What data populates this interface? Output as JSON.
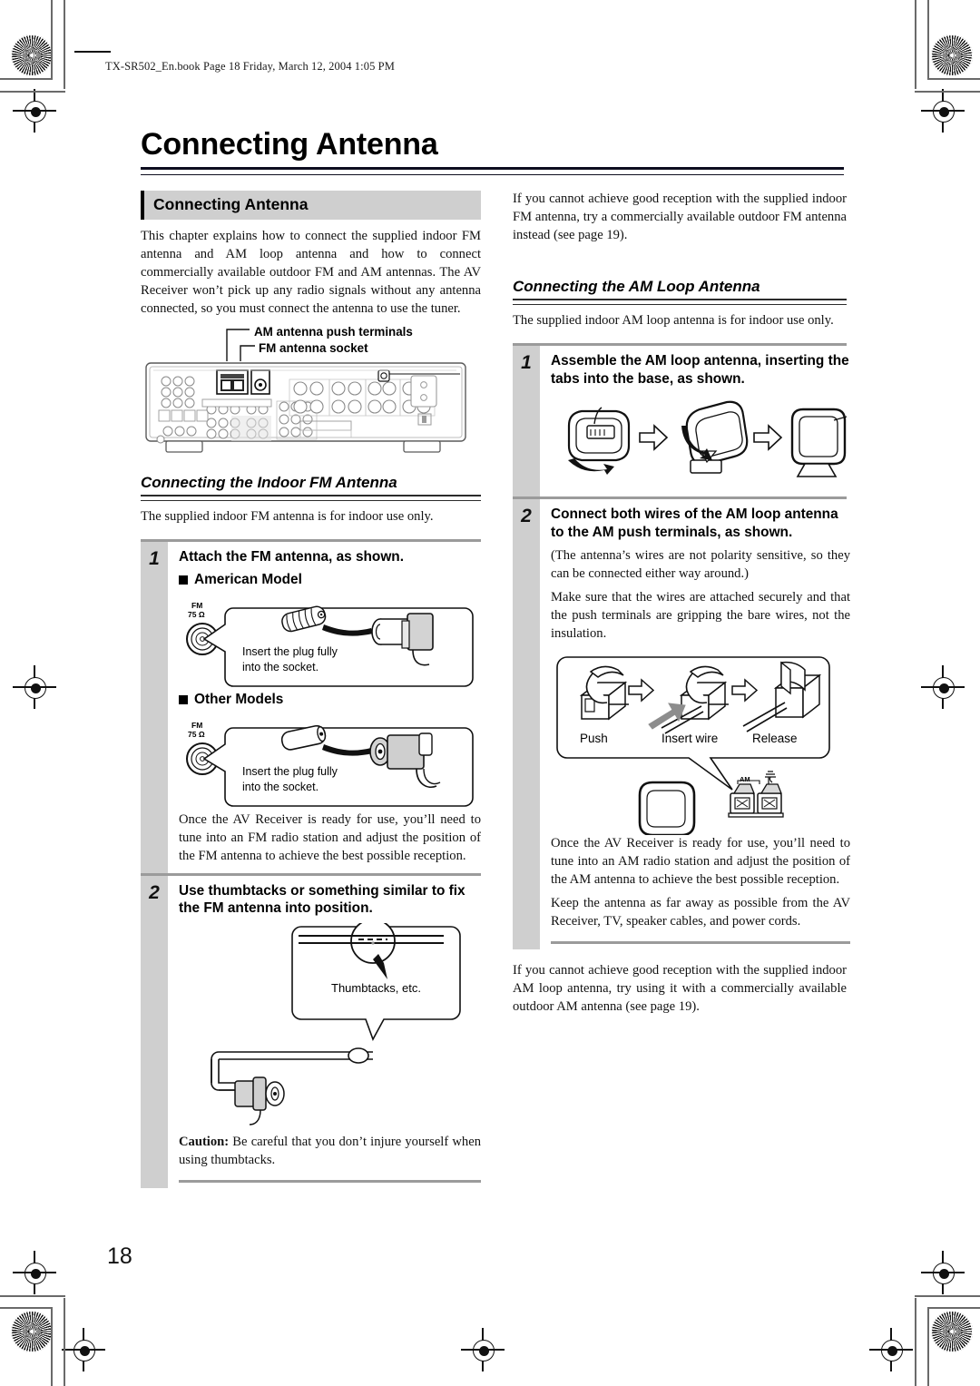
{
  "header": {
    "file_line": "TX-SR502_En.book  Page 18  Friday, March 12, 2004  1:05 PM"
  },
  "page_title": "Connecting Antenna",
  "page_number": "18",
  "left_column": {
    "section_bar": "Connecting Antenna",
    "intro": "This chapter explains how to connect the supplied indoor FM antenna and AM loop antenna and how to connect commercially available outdoor FM and AM antennas. The AV Receiver won’t pick up any radio signals without any antenna connected, so you must connect the antenna to use the tuner.",
    "receiver_labels": {
      "am_terminals": "AM antenna push terminals",
      "fm_socket": "FM antenna socket"
    },
    "fm_section": {
      "heading": "Connecting the Indoor FM Antenna",
      "intro": "The supplied indoor FM antenna is for indoor use only.",
      "step1": {
        "number": "1",
        "title": "Attach the FM antenna, as shown.",
        "bullet_american": "American Model",
        "bullet_other": "Other Models",
        "socket_label_line1": "FM",
        "socket_label_line2": "75 Ω",
        "callout_line1": "Insert the plug fully",
        "callout_line2": "into the socket.",
        "after_text": "Once the AV Receiver is ready for use, you’ll need to tune into an FM radio station and adjust the position of the FM antenna to achieve the best possible reception."
      },
      "step2": {
        "number": "2",
        "title": "Use thumbtacks or something similar to fix the FM antenna into position.",
        "callout_label": "Thumbtacks, etc.",
        "caution_label": "Caution:",
        "caution_text": " Be careful that you don’t injure yourself when using thumbtacks."
      }
    }
  },
  "right_column": {
    "fm_outdoor_note": "If you cannot achieve good reception with the supplied indoor FM antenna, try a commercially available outdoor FM antenna instead (see page 19).",
    "am_section": {
      "heading": "Connecting the AM Loop Antenna",
      "intro": "The supplied indoor AM loop antenna is for indoor use only.",
      "step1": {
        "number": "1",
        "title": "Assemble the AM loop antenna, inserting the tabs into the base, as shown."
      },
      "step2": {
        "number": "2",
        "title": "Connect both wires of the AM loop antenna to the AM push terminals, as shown.",
        "note1": "(The antenna’s wires are not polarity sensitive, so they can be connected either way around.)",
        "note2": "Make sure that the wires are attached securely and that the push terminals are gripping the bare wires, not the insulation.",
        "fig_labels": {
          "push": "Push",
          "insert": "Insert wire",
          "release": "Release",
          "terminal_am": "AM"
        },
        "after_text1": "Once the AV Receiver is ready for use, you’ll need to tune into an AM radio station and adjust the position of the AM antenna to achieve the best possible reception.",
        "after_text2": "Keep the antenna as far away as possible from the AV Receiver, TV, speaker cables, and power cords."
      }
    },
    "am_outdoor_note": "If you cannot achieve good reception with the supplied indoor AM loop antenna, try using it with a commercially available outdoor AM antenna (see page 19)."
  },
  "colors": {
    "gray_bar": "#cfcfcf",
    "rule": "#9b9b9b",
    "text": "#111111"
  }
}
